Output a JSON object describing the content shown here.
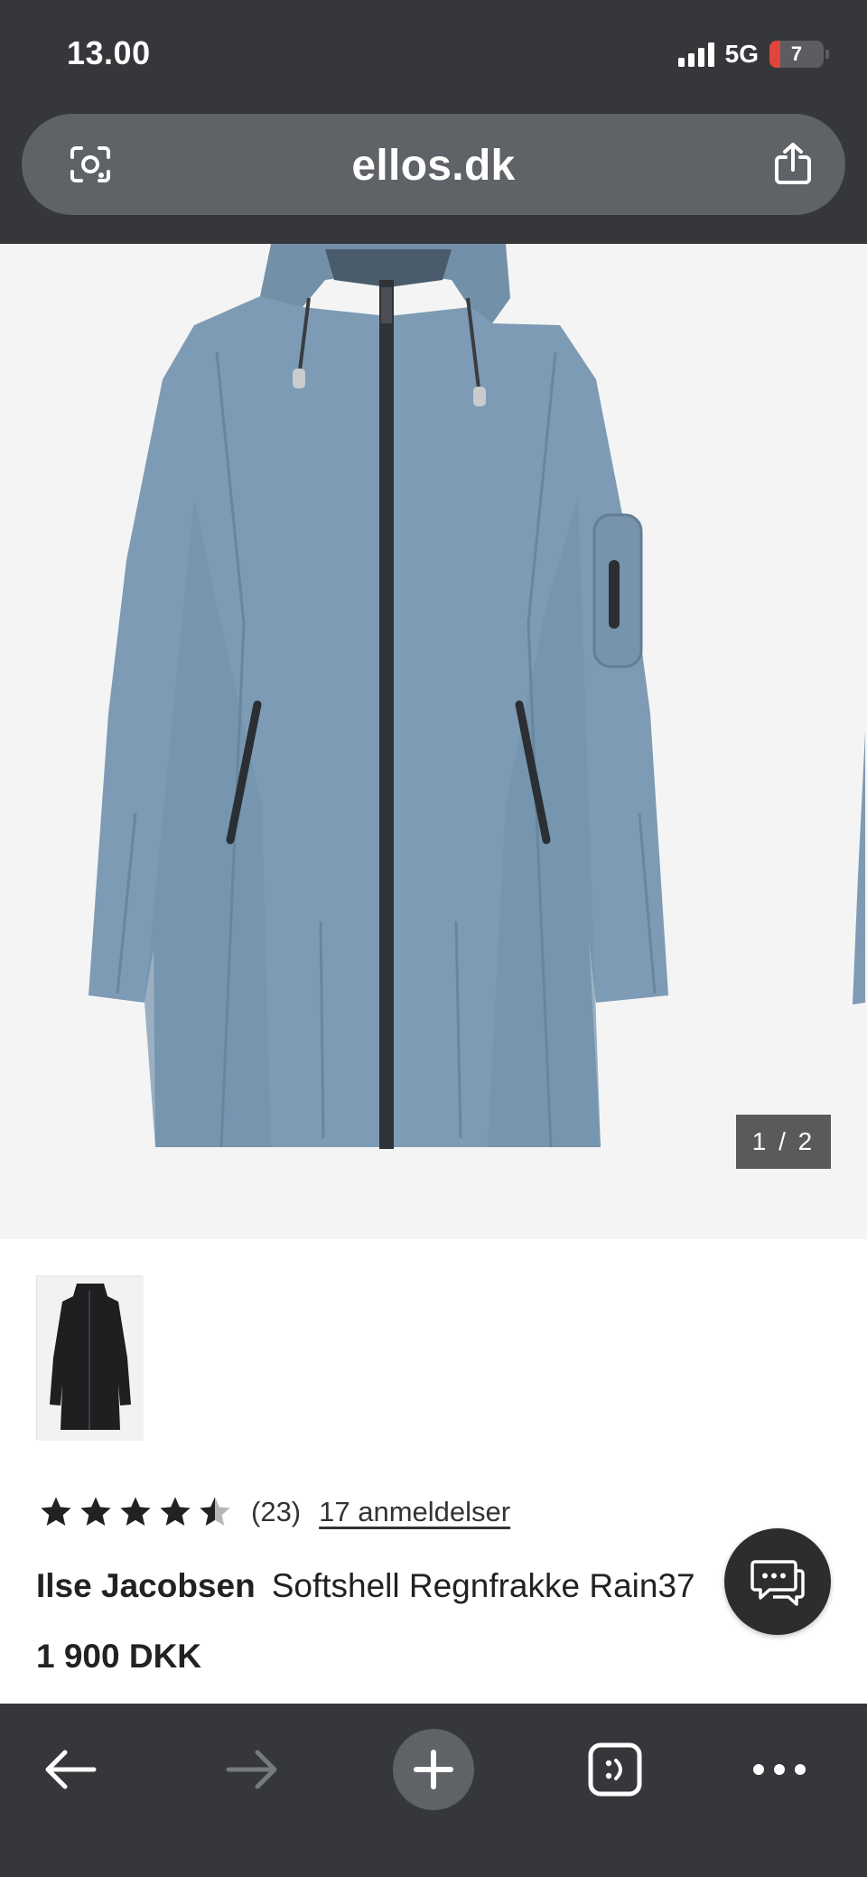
{
  "status_bar": {
    "time": "13.00",
    "network": "5G",
    "battery": "7"
  },
  "browser": {
    "url": "ellos.dk"
  },
  "gallery": {
    "counter": "1 / 2"
  },
  "product": {
    "rating_count": "(23)",
    "reviews_link": "17 anmeldelser",
    "stars": 4.5,
    "brand": "Ilse Jacobsen",
    "name": "Softshell Regnfrakke Rain37",
    "price": "1 900 DKK"
  },
  "colors": {
    "chrome": "#35373a",
    "url_bar": "#5f6266",
    "jacket": "#7d9bb5",
    "accent_dark": "#2d2d2d"
  },
  "icons": {
    "url_left": "lens-icon",
    "url_right": "share-icon",
    "chat": "chat-icon",
    "back": "back-arrow-icon",
    "forward": "forward-arrow-icon",
    "new_tab": "plus-icon",
    "tabs": "tabs-icon",
    "more": "more-icon"
  }
}
